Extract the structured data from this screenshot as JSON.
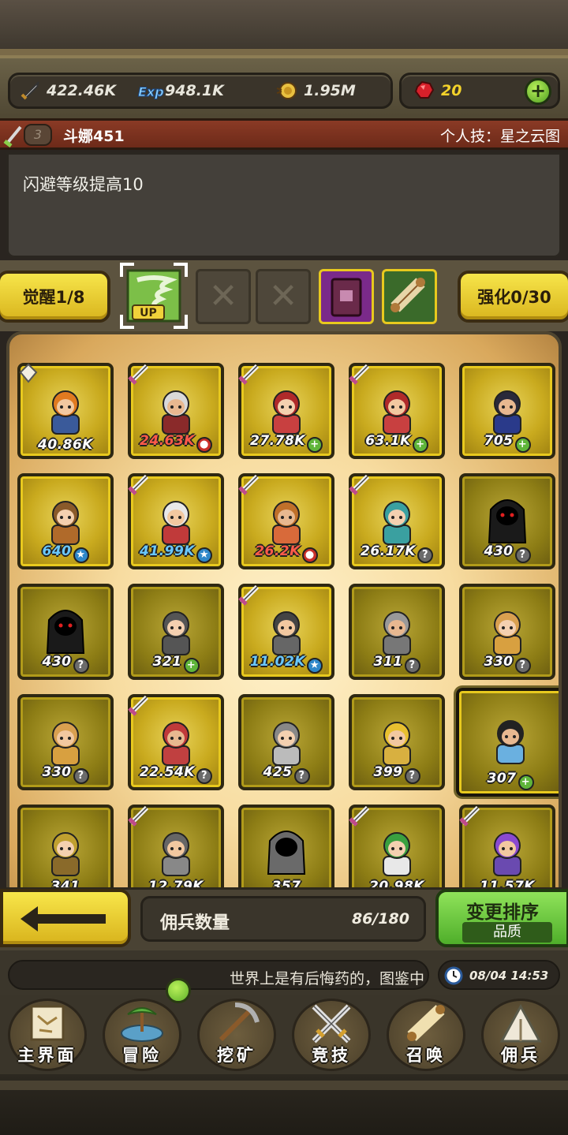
{
  "resources": {
    "power": "422.46K",
    "exp": "948.1K",
    "gold": "1.95M",
    "gems": "20",
    "power_icon": "sword-icon",
    "exp_icon": "exp-icon",
    "gold_icon": "coin-icon",
    "gem_icon": "ruby-icon",
    "add_icon": "plus-icon"
  },
  "hero": {
    "level": "3",
    "name": "斗娜451",
    "skill": "个人技：星之云图",
    "description": "闪避等级提高10"
  },
  "awaken": {
    "label": "觉醒1/8"
  },
  "enhance": {
    "label": "强化0/30"
  },
  "equip_slots": [
    {
      "icon": "tornado-up-icon",
      "badge": "UP"
    },
    {
      "icon": "empty-x-icon"
    },
    {
      "icon": "empty-x-icon"
    },
    {
      "icon": "book-icon"
    },
    {
      "icon": "scroll-icon"
    }
  ],
  "mercenaries": [
    {
      "value": "40.86K",
      "badge": "",
      "tag": "paper"
    },
    {
      "value": "24.63K",
      "badge": "red",
      "tag": "sword"
    },
    {
      "value": "27.78K",
      "badge": "plus",
      "tag": "sword"
    },
    {
      "value": "63.1K",
      "badge": "plus",
      "tag": "sword"
    },
    {
      "value": "705",
      "badge": "plus",
      "tag": ""
    },
    {
      "value": "640",
      "badge": "star",
      "tag": ""
    },
    {
      "value": "41.99K",
      "badge": "star",
      "tag": "sword"
    },
    {
      "value": "26.2K",
      "badge": "red",
      "tag": "sword"
    },
    {
      "value": "26.17K",
      "badge": "q",
      "tag": "sword"
    },
    {
      "value": "430",
      "badge": "q",
      "tag": ""
    },
    {
      "value": "430",
      "badge": "q",
      "tag": ""
    },
    {
      "value": "321",
      "badge": "plus",
      "tag": ""
    },
    {
      "value": "11.02K",
      "badge": "star",
      "tag": "sword"
    },
    {
      "value": "311",
      "badge": "q",
      "tag": ""
    },
    {
      "value": "330",
      "badge": "q",
      "tag": ""
    },
    {
      "value": "330",
      "badge": "q",
      "tag": ""
    },
    {
      "value": "22.54K",
      "badge": "q",
      "tag": "sword"
    },
    {
      "value": "425",
      "badge": "q",
      "tag": ""
    },
    {
      "value": "399",
      "badge": "q",
      "tag": ""
    },
    {
      "value": "307",
      "badge": "plus",
      "tag": "",
      "selected": true
    },
    {
      "value": "341",
      "badge": "",
      "tag": ""
    },
    {
      "value": "12.79K",
      "badge": "",
      "tag": "sword"
    },
    {
      "value": "357",
      "badge": "",
      "tag": ""
    },
    {
      "value": "20.98K",
      "badge": "",
      "tag": "sword"
    },
    {
      "value": "11.57K",
      "badge": "",
      "tag": "sword"
    }
  ],
  "actions": {
    "count_label": "佣兵数量",
    "count_value": "86/180",
    "sort_label": "变更排序",
    "sort_sub": "品质"
  },
  "ticker": {
    "text": "世界上是有后悔药的，图鉴中",
    "time": "08/04 14:53"
  },
  "nav": [
    {
      "label": "主界面",
      "icon": "map-scroll-icon"
    },
    {
      "label": "冒险",
      "icon": "island-icon"
    },
    {
      "label": "挖矿",
      "icon": "pickaxe-icon"
    },
    {
      "label": "竞技",
      "icon": "crossed-swords-icon"
    },
    {
      "label": "召唤",
      "icon": "summon-scroll-icon"
    },
    {
      "label": "佣兵",
      "icon": "tent-icon"
    }
  ],
  "colors": {
    "gold": "#e8c91e",
    "green": "#5fb53a",
    "red_bar": "#8a3a25",
    "panel": "#44403a"
  }
}
